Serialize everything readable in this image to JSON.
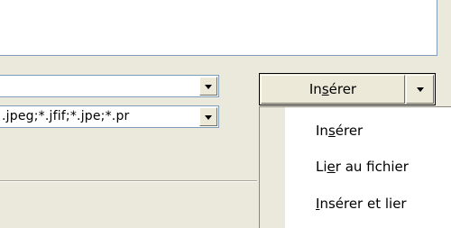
{
  "file_list": {},
  "filename_combo": {
    "value": ""
  },
  "filetype_combo": {
    "value": ".jpeg;*.jfif;*.jpe;*.pr"
  },
  "insert_button": {
    "label_parts": [
      "In",
      "s",
      "érer"
    ]
  },
  "menu": {
    "items": [
      {
        "parts": [
          "In",
          "s",
          "érer"
        ]
      },
      {
        "parts": [
          "Li",
          "e",
          "r au fichier"
        ]
      },
      {
        "parts": [
          "",
          "I",
          "nsérer et lier"
        ]
      }
    ]
  },
  "colors": {
    "dialog_bg": "#ebe8dc",
    "field_border": "#7f9db9",
    "menu_bg": "#ffffff"
  }
}
